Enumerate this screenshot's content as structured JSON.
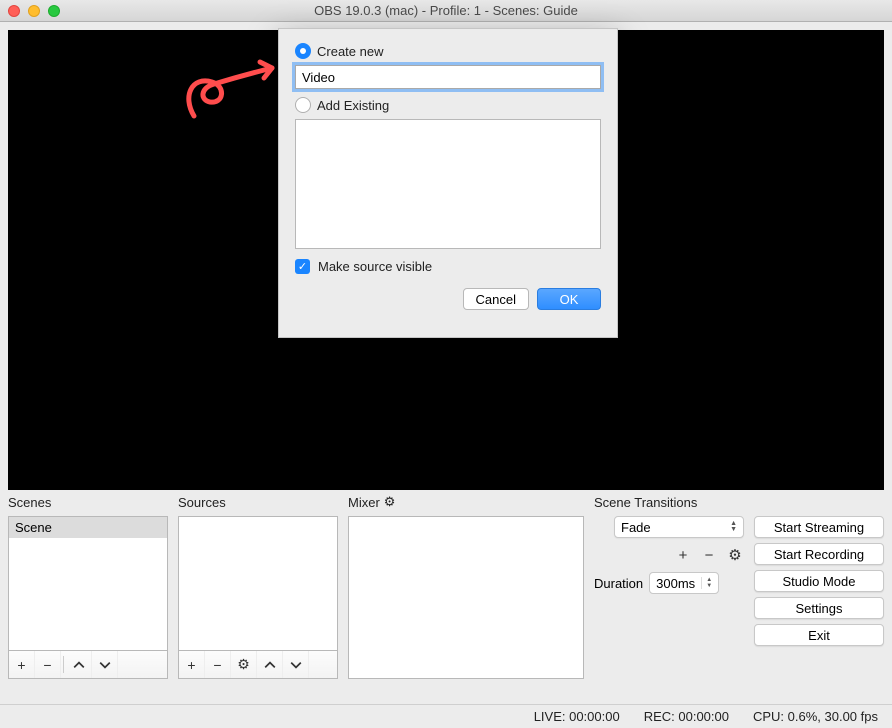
{
  "window": {
    "title": "OBS 19.0.3 (mac) - Profile: 1 - Scenes: Guide"
  },
  "panels": {
    "scenes_label": "Scenes",
    "sources_label": "Sources",
    "mixer_label": "Mixer",
    "transitions_label": "Scene Transitions",
    "scenes_items": [
      "Scene"
    ]
  },
  "transition": {
    "selected": "Fade",
    "duration_label": "Duration",
    "duration_value": "300ms"
  },
  "buttons": {
    "start_streaming": "Start Streaming",
    "start_recording": "Start Recording",
    "studio_mode": "Studio Mode",
    "settings": "Settings",
    "exit": "Exit"
  },
  "status": {
    "live": "LIVE: 00:00:00",
    "rec": "REC: 00:00:00",
    "cpu": "CPU: 0.6%, 30.00 fps"
  },
  "dialog": {
    "create_new_label": "Create new",
    "name_value": "Video",
    "add_existing_label": "Add Existing",
    "make_visible_label": "Make source visible",
    "cancel": "Cancel",
    "ok": "OK"
  },
  "icons": {
    "plus": "+",
    "minus": "−",
    "up": "⌃",
    "down": "⌄",
    "gear": "⚙",
    "check": "✓"
  }
}
